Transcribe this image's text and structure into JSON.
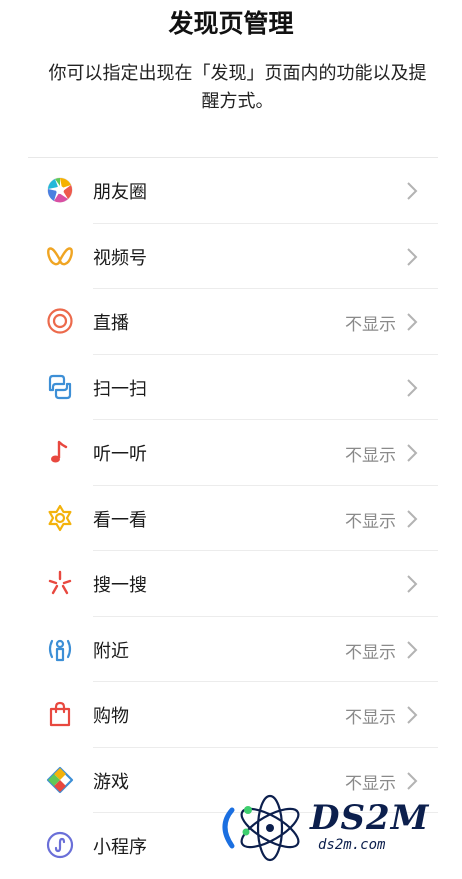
{
  "header": {
    "title": "发现页管理",
    "description": "你可以指定出现在「发现」页面内的功能以及提醒方式。"
  },
  "items": [
    {
      "label": "朋友圈",
      "status": "",
      "icon": "moments-aperture-icon"
    },
    {
      "label": "视频号",
      "status": "",
      "icon": "channels-icon"
    },
    {
      "label": "直播",
      "status": "不显示",
      "icon": "live-icon"
    },
    {
      "label": "扫一扫",
      "status": "",
      "icon": "scan-icon"
    },
    {
      "label": "听一听",
      "status": "不显示",
      "icon": "music-note-icon"
    },
    {
      "label": "看一看",
      "status": "不显示",
      "icon": "top-stories-icon"
    },
    {
      "label": "搜一搜",
      "status": "",
      "icon": "search-burst-icon"
    },
    {
      "label": "附近",
      "status": "不显示",
      "icon": "nearby-icon"
    },
    {
      "label": "购物",
      "status": "不显示",
      "icon": "shopping-bag-icon"
    },
    {
      "label": "游戏",
      "status": "不显示",
      "icon": "games-icon"
    },
    {
      "label": "小程序",
      "status": "",
      "icon": "mini-programs-icon"
    }
  ],
  "watermark": {
    "line1": "DS2M",
    "line2": "ds2m.com"
  }
}
